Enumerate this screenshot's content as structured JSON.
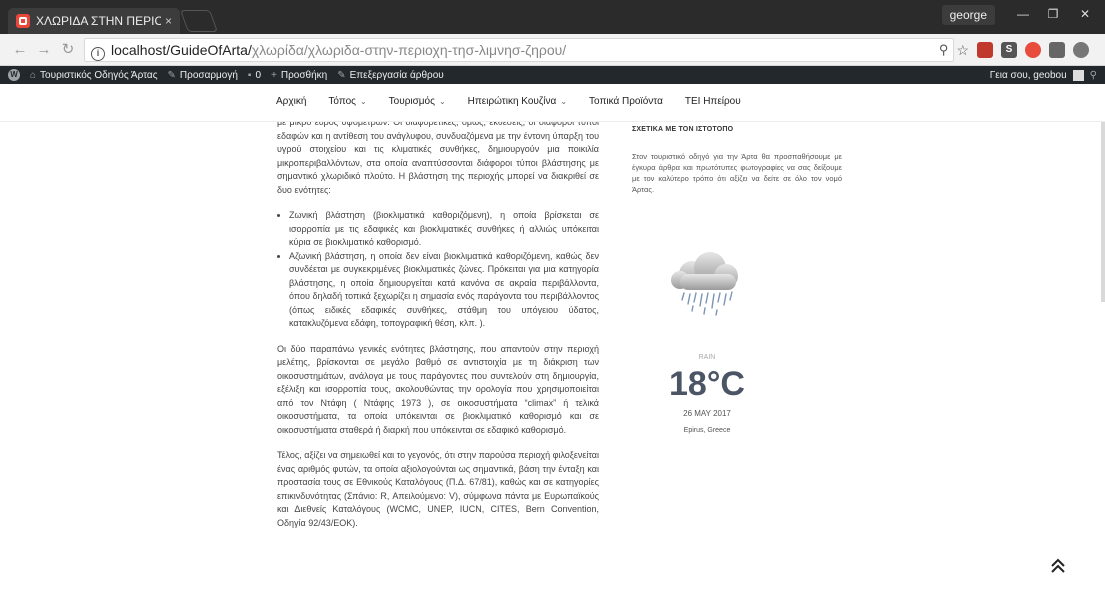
{
  "browser": {
    "tab_title": "ΧΛΩΡΙΔΑ ΣΤΗΝ ΠΕΡΙΟΧΗ",
    "tab_close": "×",
    "profile_name": "george",
    "url_host": "localhost/GuideOfArta/",
    "url_path": "χλωρίδα/χλωριδα-στην-περιοχη-τησ-λιμνησ-ζηρου/"
  },
  "wp_admin_bar": {
    "site_name": "Τουριστικός Οδηγός Άρτας",
    "customize": "Προσαρμογή",
    "comments_count": "0",
    "new": "Προσθήκη",
    "edit": "Επεξεργασία άρθρου",
    "greeting": "Γεια σου, geobou"
  },
  "site_nav": {
    "items": [
      "Αρχική",
      "Τόπος",
      "Τουρισμός",
      "Ηπειρώτικη Κουζίνα",
      "Τοπικά Προϊόντα",
      "ΤΕΙ Ηπείρου"
    ]
  },
  "article": {
    "p1": "με μικρό εύρος υψομέτρων. Οι διαφορετικές, όμως, εκθέσεις, οι διάφοροι τύποι εδαφών και η αντίθεση του ανάγλυφου, συνδυαζόμενα με την έντονη ύπαρξη του υγρού στοιχείου και τις κλιματικές συνθήκες, δημιουργούν μια ποικιλία μικροπεριβαλλόντων, στα οποία αναπτύσσονται διάφοροι τύποι βλάστησης με σημαντικό χλωριδικό πλούτο. Η βλάστηση της περιοχής μπορεί να διακριθεί σε δυο ενότητες:",
    "bullet1": "Ζωνική βλάστηση (βιοκλιματικά καθοριζόμενη), η οποία βρίσκεται σε ισορροπία με τις εδαφικές και βιοκλιματικές συνθήκες ή αλλιώς υπόκειται κύρια σε βιοκλιματικό καθορισμό.",
    "bullet2": "Αζωνική βλάστηση, η οποία δεν είναι βιοκλιματικά καθοριζόμενη, καθώς δεν συνδέεται με συγκεκριμένες βιοκλιματικές ζώνες. Πρόκειται για μια κατηγορία βλάστησης, η οποία δημιουργείται κατά κανόνα σε ακραία περιβάλλοντα, όπου δηλαδή τοπικά ξεχωρίζει η σημασία ενός παράγοντα του περιβάλλοντος (όπως ειδικές εδαφικές συνθήκες, στάθμη του υπόγειου ύδατος, κατακλυζόμενα εδάφη, τοπογραφική θέση, κλπ. ).",
    "p2": "Οι δύο παραπάνω γενικές ενότητες βλάστησης, που απαντούν στην περιοχή μελέτης, βρίσκονται σε μεγάλο βαθμό σε αντιστοιχία με τη διάκριση των οικοσυστημάτων, ανάλογα με τους παράγοντες που συντελούν στη δημιουργία, εξέλιξη και ισορροπία τους, ακολουθώντας την ορολογία που χρησιμοποιείται από τον Ντάφη ( Ντάφης 1973 ), σε οικοσυστήματα “climax” ή τελικά οικοσυστήματα, τα οποία υπόκεινται σε βιοκλιματικό καθορισμό και σε οικοσυστήματα σταθερά ή διαρκή που υπόκεινται σε εδαφικό καθορισμό.",
    "p3": "Τέλος, αξίζει να σημειωθεί και το γεγονός, ότι στην παρούσα περιοχή φιλοξενείται ένας αριθμός φυτών, τα οποία αξιολογούνται ως σημαντικά, βάση την ένταξη και προστασία τους σε Εθνικούς Καταλόγους (Π.Δ. 67/81), καθώς και σε κατηγορίες επικινδυνότητας (Σπάνιο: R, Απειλούμενο: V), σύμφωνα πάντα με Ευρωπαϊκούς και Διεθνείς Καταλόγους (WCMC, UNEP, IUCN, CITES, Bern Convention, Οδηγία 92/43/ΕΟΚ)."
  },
  "sidebar": {
    "heading": "ΣΧΕΤΙΚΑ ΜΕ ΤΟΝ ΙΣΤΟΤΟΠΟ",
    "text": "Στον τουριστικό οδηγό για την Άρτα θα προσπαθήσουμε με έγκυρα άρθρα και πρωτότυπες φωτογραφίες να σας δείξουμε με τον καλύτερο τρόπο ότι αξίζει να δείτε σε όλο τον νομό Άρτας.",
    "weather": {
      "condition": "RAIN",
      "temperature": "18°C",
      "date": "26 MAY 2017",
      "location": "Epirus, Greece",
      "icon": "rain-cloud-icon"
    }
  }
}
